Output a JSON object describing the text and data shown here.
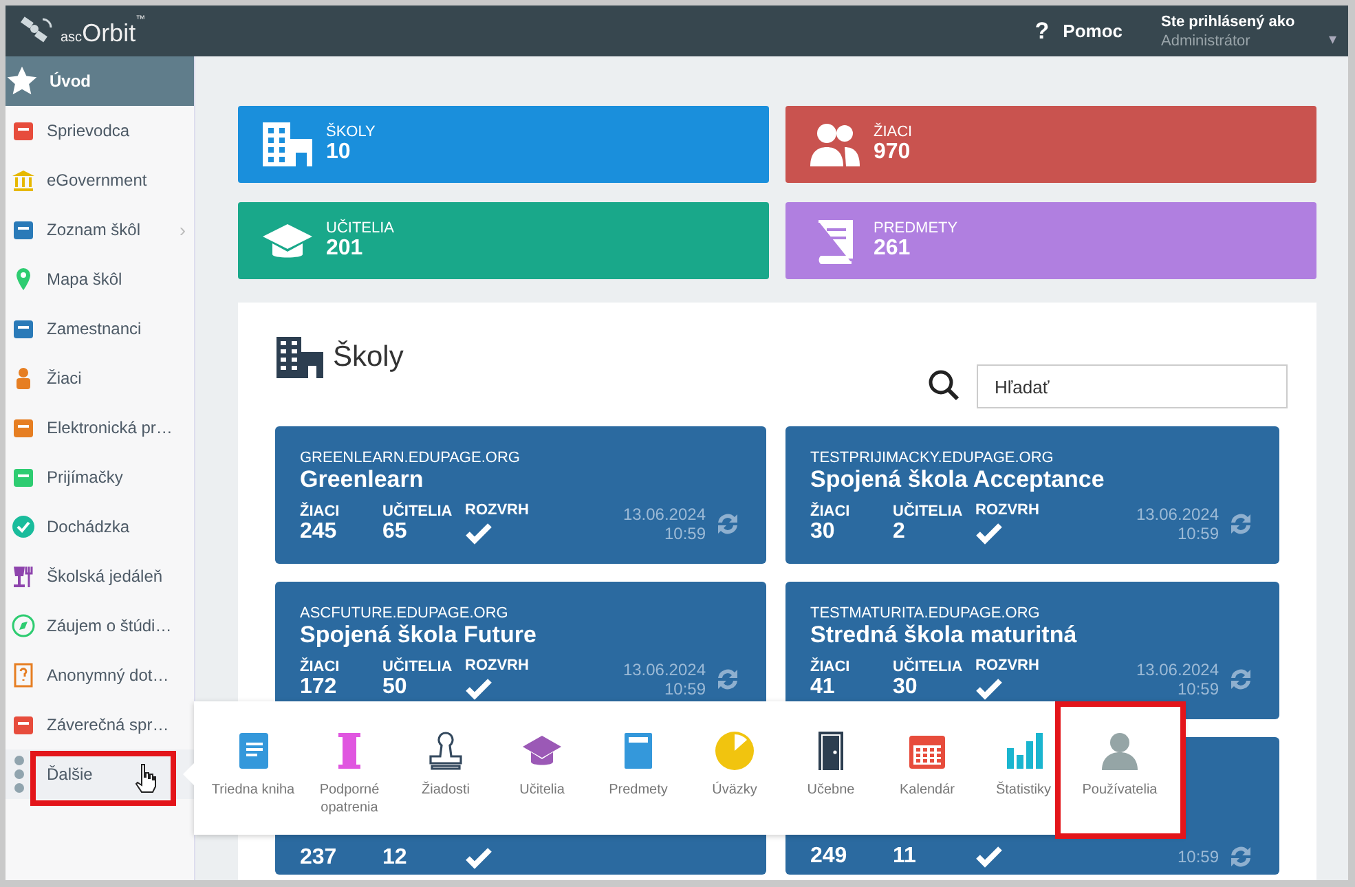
{
  "topbar": {
    "logo_prefix": "asc",
    "logo": "Orbit",
    "logo_mark": "™",
    "help_icon": "?",
    "help": "Pomoc",
    "user_label": "Ste prihlásený ako",
    "user_name": "Administrátor",
    "dropdown": "▾"
  },
  "sidebar": {
    "items": [
      {
        "label": "Úvod",
        "selected": true,
        "kind": "item"
      },
      {
        "label": "Sprievodca",
        "selected": false,
        "kind": "item"
      },
      {
        "label": "eGovernment",
        "selected": false,
        "kind": "item"
      },
      {
        "label": "Zoznam škôl",
        "selected": false,
        "kind": "item",
        "submenu": "›"
      },
      {
        "label": "Mapa škôl",
        "selected": false,
        "kind": "item"
      },
      {
        "label": "Zamestnanci",
        "selected": false,
        "kind": "item"
      },
      {
        "label": "Žiaci",
        "selected": false,
        "kind": "item"
      },
      {
        "label": "Elektronická pr…",
        "selected": false,
        "kind": "item"
      },
      {
        "label": "Prijímačky",
        "selected": false,
        "kind": "item"
      },
      {
        "label": "Dochádzka",
        "selected": false,
        "kind": "item"
      },
      {
        "label": "Školská jedáleň",
        "selected": false,
        "kind": "item"
      },
      {
        "label": "Záujem o štúdi…",
        "selected": false,
        "kind": "item"
      },
      {
        "label": "Anonymný dot…",
        "selected": false,
        "kind": "item"
      },
      {
        "label": "Záverečná spr…",
        "selected": false,
        "kind": "item"
      },
      {
        "label": "Ďalšie",
        "selected": false,
        "kind": "more",
        "highlighted": true
      }
    ]
  },
  "stats": [
    {
      "label": "ŠKOLY",
      "value": "10",
      "color": "#1a8fdc"
    },
    {
      "label": "ŽIACI",
      "value": "970",
      "color": "#c9534f"
    },
    {
      "label": "UČITELIA",
      "value": "201",
      "color": "#19a88a"
    },
    {
      "label": "PREDMETY",
      "value": "261",
      "color": "#b07fe0"
    }
  ],
  "schools_panel": {
    "title": "Školy",
    "search": {
      "placeholder": "Hľadať"
    },
    "cards": [
      {
        "domain": "GREENLEARN.EDUPAGE.ORG",
        "name": "Greenlearn",
        "students_label": "ŽIACI",
        "students": "245",
        "teachers_label": "UČITELIA",
        "teachers": "65",
        "timetable_label": "ROZVRH",
        "timetable": true,
        "date": "13.06.2024",
        "time": "10:59"
      },
      {
        "domain": "TESTPRIJIMACKY.EDUPAGE.ORG",
        "name": "Spojená škola Acceptance",
        "students_label": "ŽIACI",
        "students": "30",
        "teachers_label": "UČITELIA",
        "teachers": "2",
        "timetable_label": "ROZVRH",
        "timetable": true,
        "date": "13.06.2024",
        "time": "10:59"
      },
      {
        "domain": "ASCFUTURE.EDUPAGE.ORG",
        "name": "Spojená škola Future",
        "students_label": "ŽIACI",
        "students": "172",
        "teachers_label": "UČITELIA",
        "teachers": "50",
        "timetable_label": "ROZVRH",
        "timetable": true,
        "date": "13.06.2024",
        "time": "10:59"
      },
      {
        "domain": "TESTMATURITA.EDUPAGE.ORG",
        "name": "Stredná škola maturitná",
        "students_label": "ŽIACI",
        "students": "41",
        "teachers_label": "UČITELIA",
        "teachers": "30",
        "timetable_label": "ROZVRH",
        "timetable": true,
        "date": "13.06.2024",
        "time": "10:59"
      },
      {
        "students": "237",
        "teachers": "12",
        "timetable": true
      },
      {
        "students": "249",
        "teachers": "11",
        "timetable": true,
        "time": "10:59"
      }
    ]
  },
  "more_menu": {
    "items": [
      {
        "label": "Triedna kniha",
        "highlighted": false
      },
      {
        "label": "Podporné opatrenia",
        "highlighted": false
      },
      {
        "label": "Žiadosti",
        "highlighted": false
      },
      {
        "label": "Učitelia",
        "highlighted": false
      },
      {
        "label": "Predmety",
        "highlighted": false
      },
      {
        "label": "Úväzky",
        "highlighted": false
      },
      {
        "label": "Učebne",
        "highlighted": false
      },
      {
        "label": "Kalendár",
        "highlighted": false
      },
      {
        "label": "Štatistiky",
        "highlighted": false
      },
      {
        "label": "Používatelia",
        "highlighted": true
      }
    ]
  }
}
